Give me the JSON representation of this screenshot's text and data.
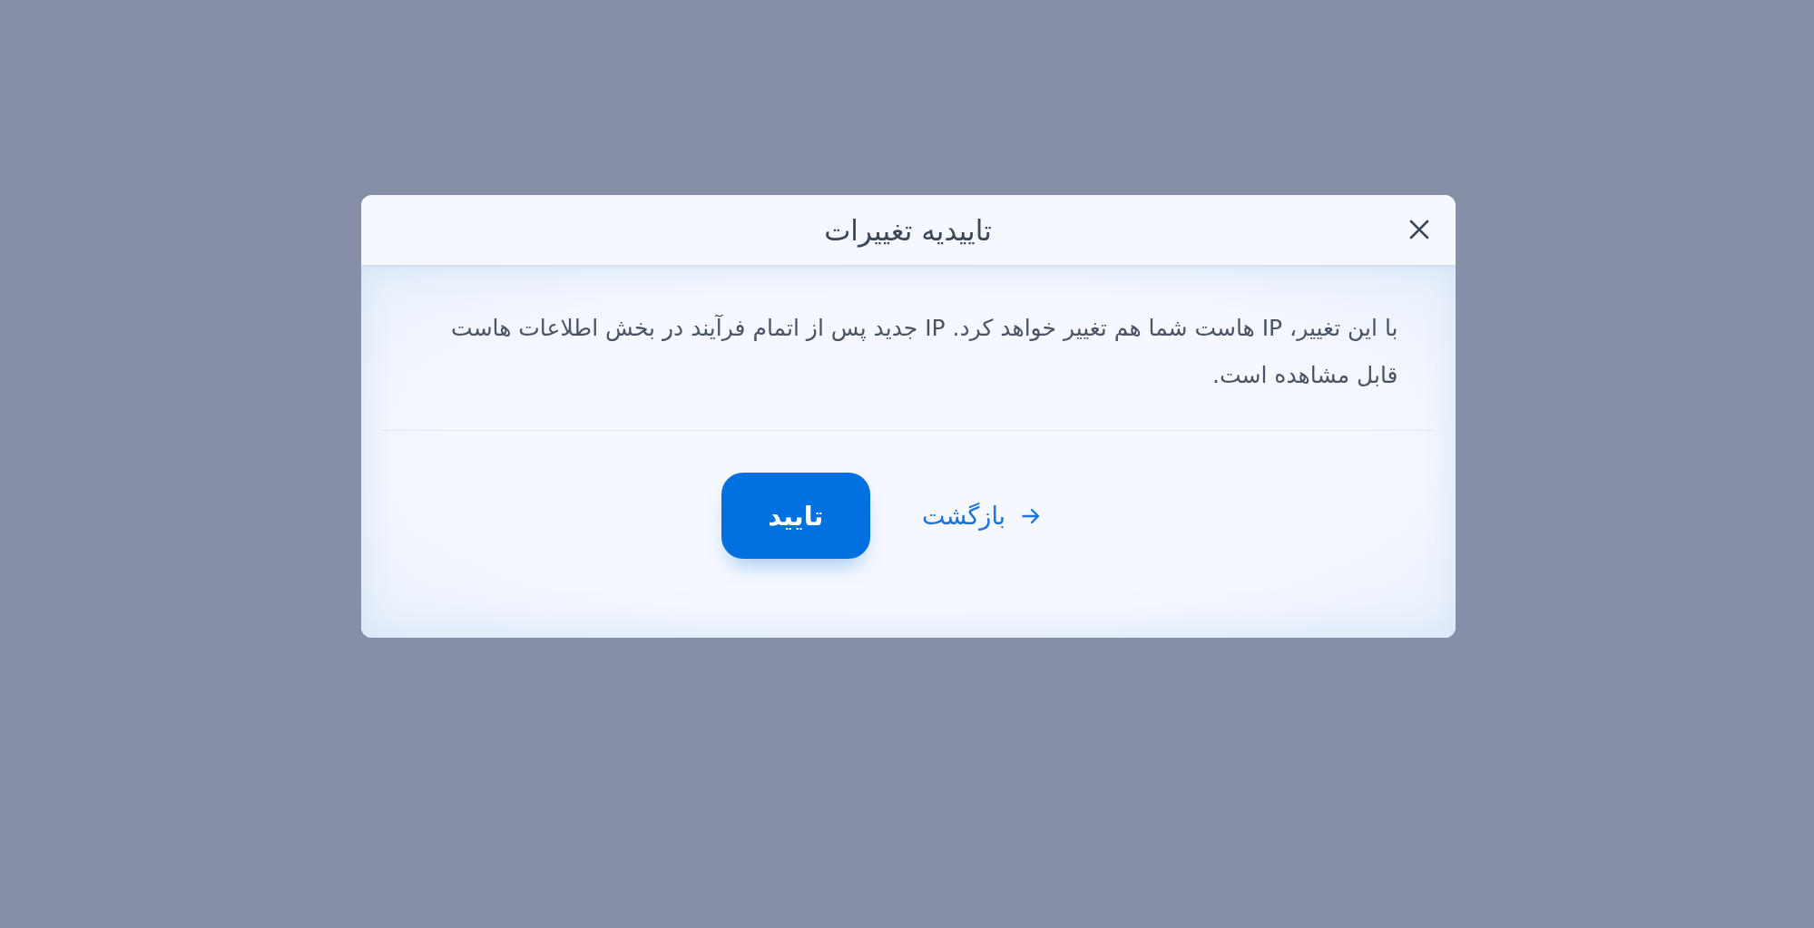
{
  "dialog": {
    "title": "تاییدیه تغییرات",
    "message": "با این تغییر، IP هاست شما هم تغییر خواهد کرد. IP جدید پس از اتمام فرآیند در بخش اطلاعات هاست قابل مشاهده است.",
    "buttons": [
      {
        "kind": "link",
        "label": "بازگشت"
      },
      {
        "kind": "primary",
        "label": "تایید"
      }
    ]
  }
}
